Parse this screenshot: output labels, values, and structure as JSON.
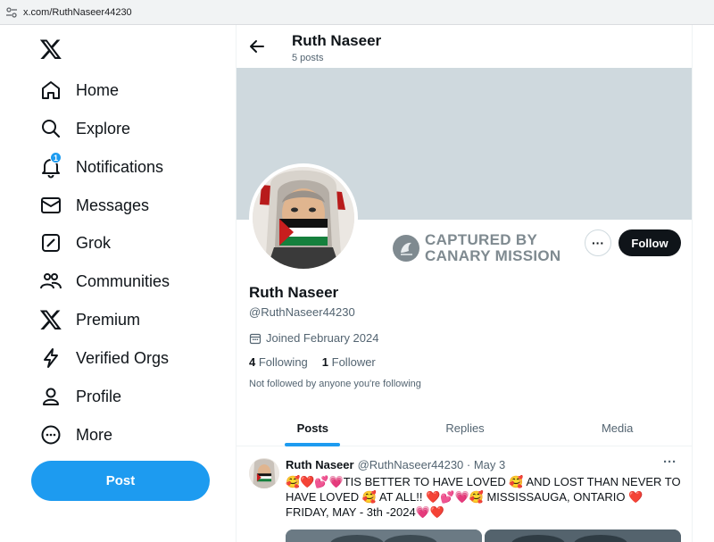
{
  "browser": {
    "url": "x.com/RuthNaseer44230"
  },
  "sidebar": {
    "items": [
      {
        "label": "Home",
        "icon": "home-icon"
      },
      {
        "label": "Explore",
        "icon": "search-icon"
      },
      {
        "label": "Notifications",
        "icon": "bell-icon",
        "badge": "1"
      },
      {
        "label": "Messages",
        "icon": "envelope-icon"
      },
      {
        "label": "Grok",
        "icon": "grok-icon"
      },
      {
        "label": "Communities",
        "icon": "people-icon"
      },
      {
        "label": "Premium",
        "icon": "x-logo-icon"
      },
      {
        "label": "Verified Orgs",
        "icon": "lightning-icon"
      },
      {
        "label": "Profile",
        "icon": "person-icon"
      },
      {
        "label": "More",
        "icon": "more-circle-icon"
      }
    ],
    "post_label": "Post"
  },
  "header": {
    "name": "Ruth Naseer",
    "post_count": "5 posts"
  },
  "watermark": {
    "line1": "CAPTURED BY",
    "line2": "CANARY MISSION"
  },
  "profile": {
    "name": "Ruth Naseer",
    "handle": "@RuthNaseer44230",
    "joined": "Joined February 2024",
    "following_count": "4",
    "following_label": "Following",
    "followers_count": "1",
    "followers_label": "Follower",
    "not_followed": "Not followed by anyone you're following",
    "follow_label": "Follow",
    "more_label": "···"
  },
  "tabs": [
    {
      "label": "Posts",
      "active": true
    },
    {
      "label": "Replies",
      "active": false
    },
    {
      "label": "Media",
      "active": false
    }
  ],
  "tweet": {
    "name": "Ruth Naseer",
    "meta": "@RuthNaseer44230 · May 3",
    "more": "···",
    "text": "🥰❤️💕💗TIS BETTER TO HAVE LOVED 🥰 AND LOST THAN NEVER TO HAVE LOVED 🥰 AT ALL!! ❤️💕💗🥰 MISSISSAUGA, ONTARIO ❤️ FRIDAY, MAY - 3th -2024💗❤️"
  },
  "colors": {
    "accent": "#1d9bf0",
    "banner": "#cfd9de",
    "text_secondary": "#536471"
  }
}
